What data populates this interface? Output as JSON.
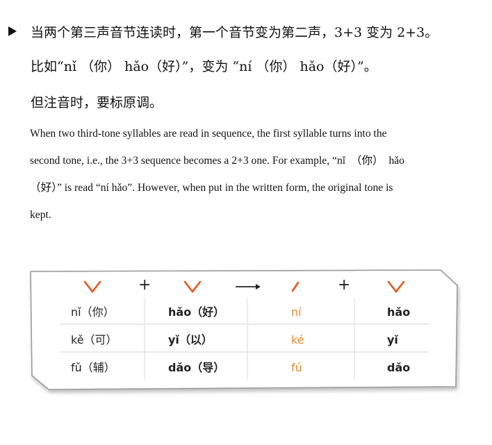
{
  "rule": {
    "bullet_text": "当两个第三声音节连读时，第一个音节变为第二声，3+3 变为 2+3。",
    "example_text": "比如“nǐ （你） hǎo（好）”，变为 “ní （你） hǎo（好）”。",
    "note_text": "但注音时，要标原调。"
  },
  "translation": {
    "lines": [
      "When two third-tone syllables are read in sequence, the first syllable turns into the",
      "second tone, i.e., the 3+3 sequence becomes a 2+3 one. For example, “nǐ  （你）  hǎo",
      "（好）” is read “ní hǎo”. However, when put in the written form, the original tone is",
      "kept."
    ]
  },
  "table": {
    "header": {
      "plus_1": "+",
      "plus_2": "+"
    },
    "rows": [
      {
        "first": "nǐ（你）",
        "second": "hǎo（好）",
        "result_first": "ní",
        "result_second": "hǎo"
      },
      {
        "first": "kě（可）",
        "second": "yǐ（以）",
        "result_first": "ké",
        "result_second": "yǐ"
      },
      {
        "first": "fǔ（辅）",
        "second": "dǎo（导）",
        "result_first": "fú",
        "result_second": "dǎo"
      }
    ]
  },
  "colors": {
    "tone_mark": "#e8541e",
    "result_text": "#e58a2e",
    "card_border": "#9a9a9a"
  }
}
